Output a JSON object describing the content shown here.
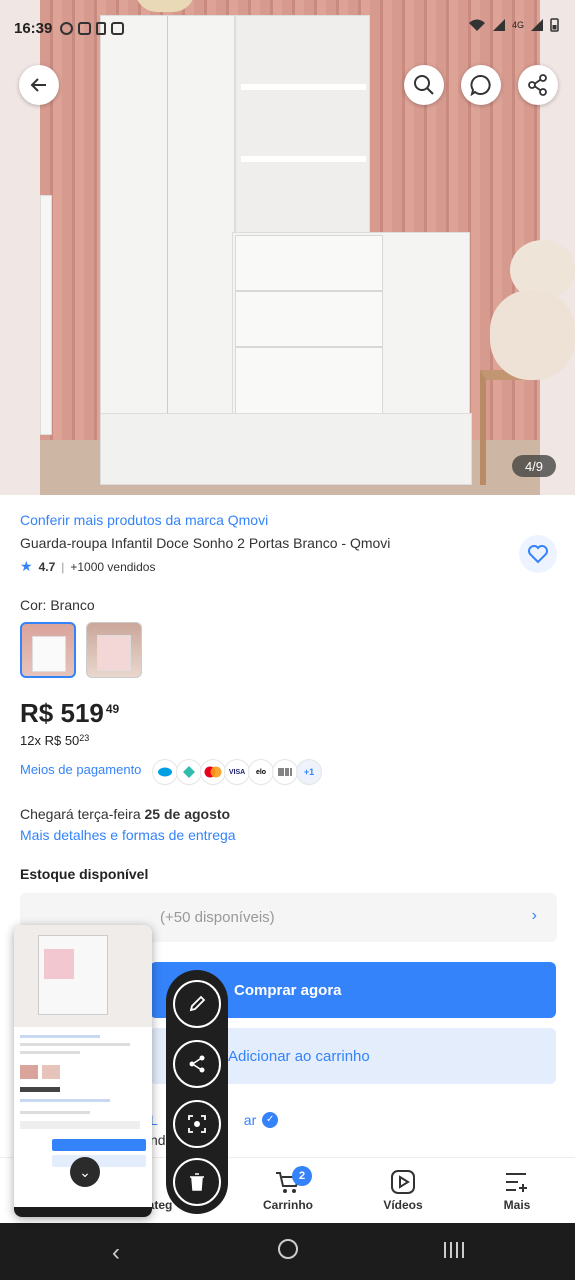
{
  "status_bar": {
    "time": "16:39",
    "right_text": "4G"
  },
  "image_gallery": {
    "counter": "4/9"
  },
  "product": {
    "brand_link": "Conferir mais produtos da marca Qmovi",
    "title": "Guarda-roupa Infantil Doce Sonho 2 Portas Branco - Qmovi",
    "rating": "4.7",
    "sold": "+1000 vendidos",
    "color_label": "Cor: Branco",
    "price_currency": "R$",
    "price_int": "519",
    "price_cents": "49",
    "installment_prefix": "12x R$",
    "installment_int": "50",
    "installment_cents": "23",
    "payments_label": "Meios de pagamento",
    "payment_icons": [
      "mercado-pago-icon",
      "pix-icon",
      "mastercard-icon",
      "visa-icon",
      "elo-icon",
      "boleto-icon"
    ],
    "payment_visa": "VISA",
    "payment_elo": "elo",
    "payment_more": "+1",
    "delivery_prefix": "Chegará terça-feira",
    "delivery_date": "25 de agosto",
    "delivery_link": "Mais detalhes e formas de entrega",
    "stock_title": "Estoque disponível",
    "stock_available": "(+50 disponíveis)",
    "buy_now": "Comprar agora",
    "add_to_cart": "Adicionar ao carrinho",
    "seller_partial": "L",
    "seller_partial_2": "ar",
    "seller_sub": "nd"
  },
  "bottom_nav": {
    "categories_partial": "ateg",
    "cart": "Carrinho",
    "cart_badge": "2",
    "videos": "Vídeos",
    "more": "Mais"
  },
  "colors": {
    "accent": "#3483fa",
    "accent_light": "#e3edfb",
    "toolbar": "#1f1f1f"
  }
}
